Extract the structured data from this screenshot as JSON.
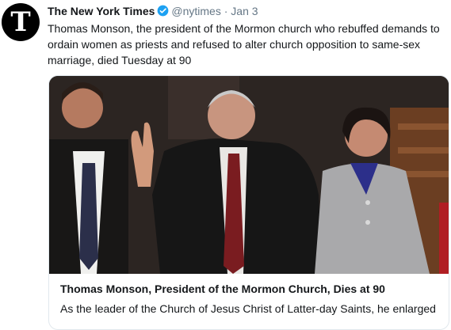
{
  "tweet": {
    "display_name": "The New York Times",
    "handle": "@nytimes",
    "separator": "·",
    "date": "Jan 3",
    "text": "Thomas Monson, the president of the Mormon church who rebuffed demands to ordain women as priests and refused to alter church opposition to same-sex marriage, died Tuesday at 90",
    "avatar_icon": "nyt-t-logo",
    "avatar_glyph": "T",
    "verified_icon": "verified-badge-icon",
    "verified_color": "#1da1f2"
  },
  "card": {
    "image_alt": "Thomas Monson waving, walking with companions",
    "title": "Thomas Monson, President of the Mormon Church, Dies at 90",
    "description": "As the leader of the Church of Jesus Christ of Latter-day Saints, he enlarged"
  }
}
